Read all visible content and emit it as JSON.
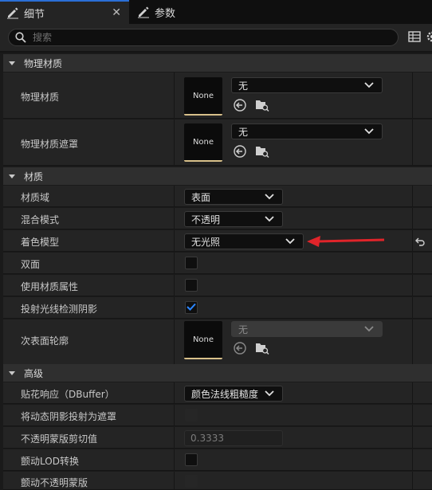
{
  "tabs": [
    {
      "label": "细节",
      "icon": "pencil-icon",
      "active": true
    },
    {
      "label": "参数",
      "icon": "pencil-icon",
      "active": false
    }
  ],
  "search": {
    "placeholder": "搜索"
  },
  "sections": {
    "physical_material": {
      "title": "物理材质",
      "rows": [
        {
          "name": "物理材质",
          "thumb": "None",
          "value": "无"
        },
        {
          "name": "物理材质遮罩",
          "thumb": "None",
          "value": "无"
        }
      ]
    },
    "material": {
      "title": "材质",
      "domain": {
        "name": "材质域",
        "value": "表面"
      },
      "blend": {
        "name": "混合模式",
        "value": "不透明"
      },
      "shading": {
        "name": "着色模型",
        "value": "无光照"
      },
      "two_sided": {
        "name": "双面",
        "checked": false
      },
      "material_attributes": {
        "name": "使用材质属性",
        "checked": false
      },
      "raytraced_shadows": {
        "name": "投射光线检测阴影",
        "checked": true
      },
      "subsurface": {
        "name": "次表面轮廓",
        "thumb": "None",
        "value": "无"
      }
    },
    "advanced": {
      "title": "高级",
      "decal": {
        "name": "贴花响应（DBuffer）",
        "value": "颜色法线粗糙度"
      },
      "dynamic_shadow": {
        "name": "将动态阴影投射为遮罩",
        "checked": false
      },
      "opacity_clip": {
        "name": "不透明蒙版剪切值",
        "value": "0.3333"
      },
      "dither_lod": {
        "name": "颤动LOD转换",
        "checked": false
      },
      "dither_opacity": {
        "name": "颤动不透明蒙版",
        "checked": false
      }
    }
  },
  "colors": {
    "accent": "#2b6fd6",
    "arrow": "#e0242a",
    "thumb_border": "#d8c08a"
  }
}
